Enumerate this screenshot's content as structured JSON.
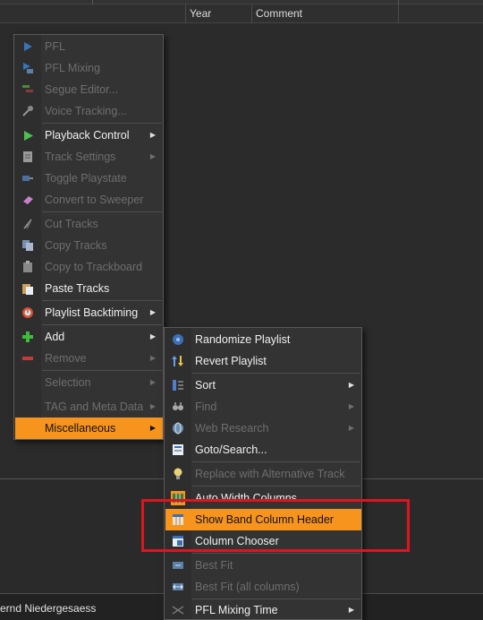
{
  "columns": {
    "year": "Year",
    "comment": "Comment"
  },
  "status": {
    "user_text": "ernd Niedergesaess"
  },
  "colors": {
    "highlight": "#f7941d",
    "annotation_box": "#e0141e",
    "menu_bg": "#333333"
  },
  "main_menu": {
    "items": [
      {
        "label": "PFL",
        "icon": "play-blue-icon",
        "enabled": false,
        "submenu": false
      },
      {
        "label": "PFL Mixing",
        "icon": "pfl-mixing-icon",
        "enabled": false,
        "submenu": false
      },
      {
        "label": "Segue Editor...",
        "icon": "segue-editor-icon",
        "enabled": false,
        "submenu": false
      },
      {
        "label": "Voice Tracking...",
        "icon": "microphone-icon",
        "enabled": false,
        "submenu": false
      },
      {
        "label": "Playback Control",
        "icon": "play-green-icon",
        "enabled": true,
        "submenu": true
      },
      {
        "label": "Track Settings",
        "icon": "document-icon",
        "enabled": false,
        "submenu": true
      },
      {
        "label": "Toggle Playstate",
        "icon": "toggle-icon",
        "enabled": false,
        "submenu": false
      },
      {
        "label": "Convert to Sweeper",
        "icon": "eraser-icon",
        "enabled": false,
        "submenu": false
      },
      {
        "label": "Cut Tracks",
        "icon": "scissors-icon",
        "enabled": false,
        "submenu": false
      },
      {
        "label": "Copy Tracks",
        "icon": "copy-icon",
        "enabled": false,
        "submenu": false
      },
      {
        "label": "Copy to Trackboard",
        "icon": "clipboard-icon",
        "enabled": false,
        "submenu": false
      },
      {
        "label": "Paste Tracks",
        "icon": "paste-icon",
        "enabled": true,
        "submenu": false
      },
      {
        "label": "Playlist Backtiming",
        "icon": "clock-icon",
        "enabled": true,
        "submenu": true
      },
      {
        "label": "Add",
        "icon": "plus-icon",
        "enabled": true,
        "submenu": true
      },
      {
        "label": "Remove",
        "icon": "minus-icon",
        "enabled": false,
        "submenu": true
      },
      {
        "label": "Selection",
        "icon": "",
        "enabled": false,
        "submenu": true
      },
      {
        "label": "TAG and Meta Data",
        "icon": "",
        "enabled": false,
        "submenu": true
      },
      {
        "label": "Miscellaneous",
        "icon": "",
        "enabled": true,
        "submenu": true,
        "highlighted": true
      }
    ]
  },
  "sub_menu": {
    "items": [
      {
        "label": "Randomize Playlist",
        "icon": "randomize-icon",
        "enabled": true,
        "submenu": false
      },
      {
        "label": "Revert Playlist",
        "icon": "revert-arrows-icon",
        "enabled": true,
        "submenu": false
      },
      {
        "label": "Sort",
        "icon": "sort-icon",
        "enabled": true,
        "submenu": true
      },
      {
        "label": "Find",
        "icon": "binoculars-icon",
        "enabled": false,
        "submenu": true
      },
      {
        "label": "Web Research",
        "icon": "globe-icon",
        "enabled": false,
        "submenu": true
      },
      {
        "label": "Goto/Search...",
        "icon": "goto-search-icon",
        "enabled": true,
        "submenu": false
      },
      {
        "label": "Replace with Alternative Track",
        "icon": "lightbulb-icon",
        "enabled": false,
        "submenu": false
      },
      {
        "label": "Auto Width Columns",
        "icon": "auto-width-icon",
        "enabled": true,
        "submenu": false
      },
      {
        "label": "Show Band Column Header",
        "icon": "band-header-icon",
        "enabled": true,
        "submenu": false,
        "highlighted": true
      },
      {
        "label": "Column Chooser",
        "icon": "column-chooser-icon",
        "enabled": true,
        "submenu": false
      },
      {
        "label": "Best Fit",
        "icon": "best-fit-icon",
        "enabled": false,
        "submenu": false
      },
      {
        "label": "Best Fit (all columns)",
        "icon": "best-fit-all-icon",
        "enabled": false,
        "submenu": false
      },
      {
        "label": "PFL Mixing Time",
        "icon": "mixing-time-icon",
        "enabled": true,
        "submenu": true
      }
    ]
  }
}
